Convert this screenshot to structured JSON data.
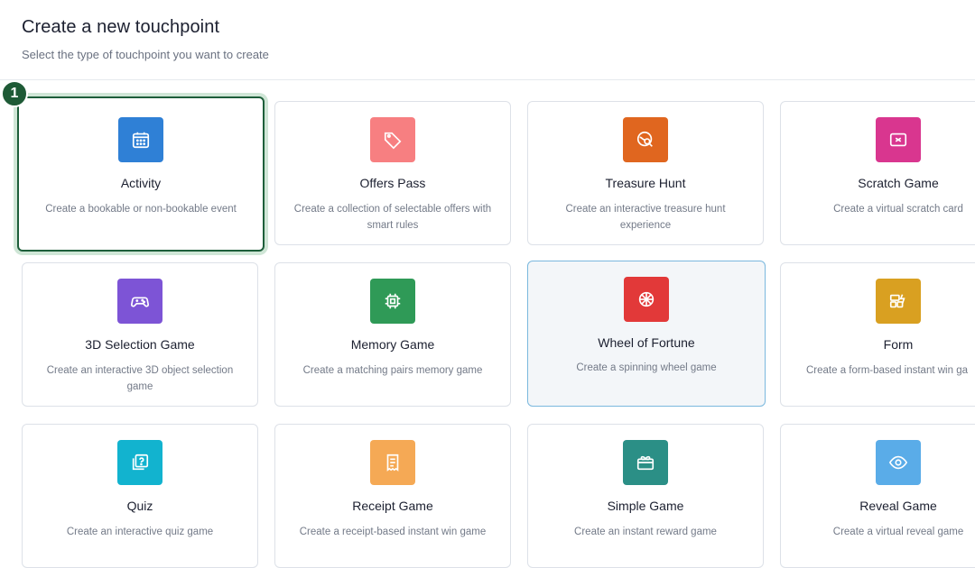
{
  "header": {
    "title": "Create a new touchpoint",
    "subtitle": "Select the type of touchpoint you want to create"
  },
  "selection_badge": "1",
  "cards": [
    {
      "title": "Activity",
      "desc": "Create a bookable or non-bookable event",
      "color": "#2f80d6",
      "icon": "calendar-icon"
    },
    {
      "title": "Offers Pass",
      "desc": "Create a collection of selectable offers with smart rules",
      "color": "#f77f81",
      "icon": "tag-icon"
    },
    {
      "title": "Treasure Hunt",
      "desc": "Create an interactive treasure hunt experience",
      "color": "#e0661f",
      "icon": "globe-search-icon"
    },
    {
      "title": "Scratch Game",
      "desc": "Create a virtual scratch card",
      "color": "#d9368f",
      "icon": "ticket-icon"
    },
    {
      "title": "3D Selection Game",
      "desc": "Create an interactive 3D object selection game",
      "color": "#7d54d6",
      "icon": "gamepad-icon"
    },
    {
      "title": "Memory Game",
      "desc": "Create a matching pairs memory game",
      "color": "#2f9a57",
      "icon": "chip-icon"
    },
    {
      "title": "Wheel of Fortune",
      "desc": "Create a spinning wheel game",
      "color": "#e23939",
      "icon": "wheel-icon"
    },
    {
      "title": "Form",
      "desc": "Create a form-based instant win ga",
      "color": "#d9a021",
      "icon": "form-icon"
    },
    {
      "title": "Quiz",
      "desc": "Create an interactive quiz game",
      "color": "#12b3cf",
      "icon": "quiz-icon"
    },
    {
      "title": "Receipt Game",
      "desc": "Create a receipt-based instant win game",
      "color": "#f5a955",
      "icon": "receipt-icon"
    },
    {
      "title": "Simple Game",
      "desc": "Create an instant reward game",
      "color": "#2b8f86",
      "icon": "gift-icon"
    },
    {
      "title": "Reveal Game",
      "desc": "Create a virtual reveal game",
      "color": "#5aace8",
      "icon": "eye-icon"
    }
  ]
}
